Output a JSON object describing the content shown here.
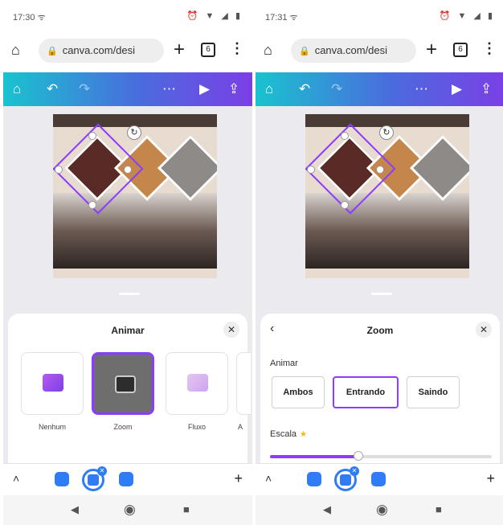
{
  "left": {
    "status": {
      "time": "17:30 ᯤ",
      "icons": "⏰ ▼ ◢ ▮"
    },
    "browser": {
      "url": "canva.com/desi",
      "tab_count": "6"
    },
    "sheet": {
      "title": "Animar",
      "options": [
        {
          "label": "Nenhum"
        },
        {
          "label": "Zoom"
        },
        {
          "label": "Fluxo"
        },
        {
          "label": "A"
        }
      ]
    }
  },
  "right": {
    "status": {
      "time": "17:31 ᯤ",
      "icons": "⏰ ▼ ◢ ▮"
    },
    "browser": {
      "url": "canva.com/desi",
      "tab_count": "6"
    },
    "sheet": {
      "title": "Zoom",
      "animar_label": "Animar",
      "choices": [
        "Ambos",
        "Entrando",
        "Saindo"
      ],
      "scale_label": "Escala",
      "scale_value": 0.4
    }
  },
  "colors": {
    "accent": "#8b3dff",
    "page_blue": "#2f7cf6"
  },
  "icons": {
    "home": "⌂",
    "lock": "🔒",
    "plus": "+",
    "menu": "⋮",
    "canva_home": "⌂",
    "undo": "↶",
    "redo": "↷",
    "more": "⋯",
    "play": "▶",
    "share": "⇪",
    "close": "✕",
    "back": "‹",
    "caret_up": "˄",
    "add": "+",
    "nav_back": "◀",
    "nav_home": "◉",
    "nav_recent": "■",
    "rotate": "↻",
    "remove": "✕"
  }
}
